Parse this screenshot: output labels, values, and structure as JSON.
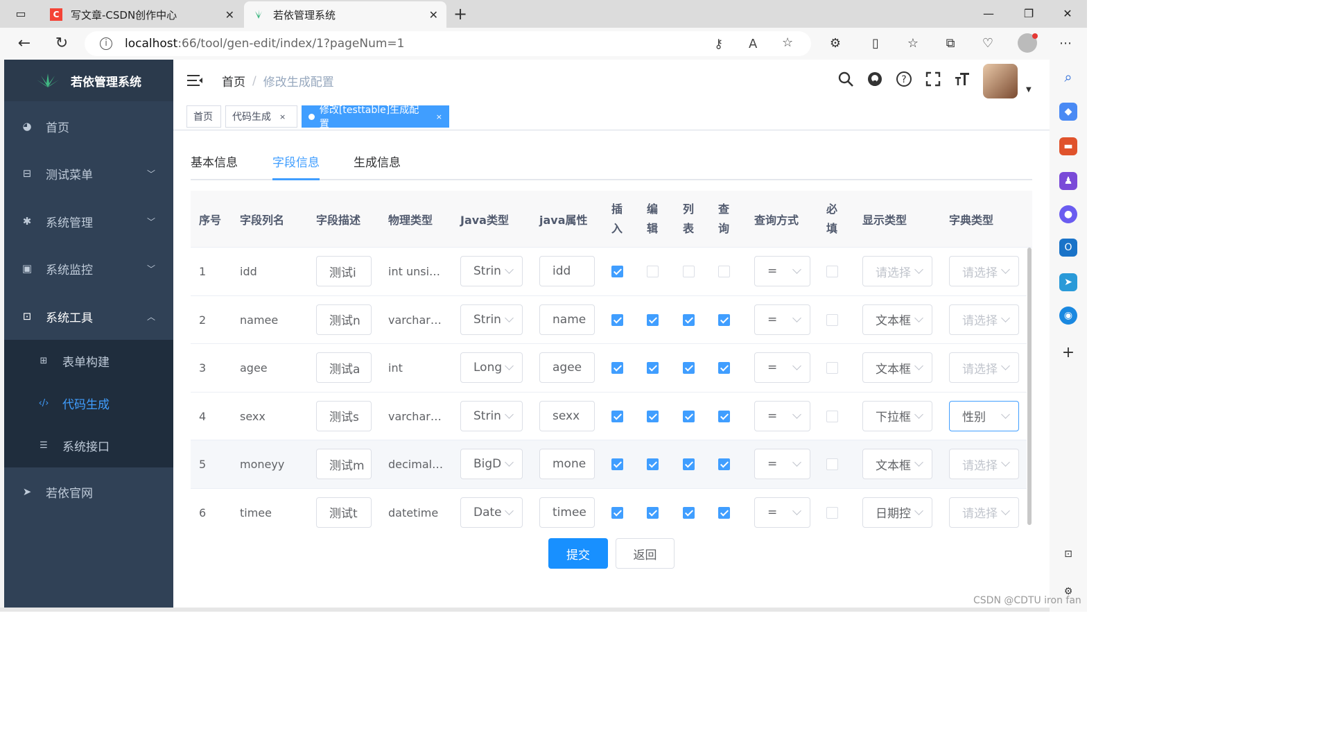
{
  "browser": {
    "tabs": [
      {
        "title": "写文章-CSDN创作中心",
        "favicon": "csdn-c-icon"
      },
      {
        "title": "若依管理系统",
        "favicon": "ruoyi-leaf-icon"
      }
    ],
    "url_host": "localhost",
    "url_path": ":66/tool/gen-edit/index/1?pageNum=1"
  },
  "sidebar": {
    "logo_title": "若依管理系统",
    "items": [
      {
        "label": "首页",
        "icon": "dashboard-icon"
      },
      {
        "label": "测试菜单",
        "icon": "tree-icon"
      },
      {
        "label": "系统管理",
        "icon": "gear-icon"
      },
      {
        "label": "系统监控",
        "icon": "monitor-icon"
      },
      {
        "label": "系统工具",
        "icon": "toolbox-icon"
      },
      {
        "label": "若依官网",
        "icon": "send-icon"
      }
    ],
    "sub_items": [
      {
        "label": "表单构建",
        "icon": "grid-icon"
      },
      {
        "label": "代码生成",
        "icon": "code-icon"
      },
      {
        "label": "系统接口",
        "icon": "sliders-icon"
      }
    ]
  },
  "breadcrumb": {
    "home": "首页",
    "current": "修改生成配置"
  },
  "tags": [
    {
      "label": "首页"
    },
    {
      "label": "代码生成",
      "close": "×"
    },
    {
      "label": "修改[testtable]生成配置",
      "close": "×"
    }
  ],
  "tabs": [
    {
      "label": "基本信息"
    },
    {
      "label": "字段信息"
    },
    {
      "label": "生成信息"
    }
  ],
  "table": {
    "headers": {
      "index": "序号",
      "column_name": "字段列名",
      "column_desc": "字段描述",
      "physical_type": "物理类型",
      "java_type": "Java类型",
      "java_field": "java属性",
      "insert": [
        "插",
        "入"
      ],
      "edit": [
        "编",
        "辑"
      ],
      "list": [
        "列",
        "表"
      ],
      "query": [
        "查",
        "询"
      ],
      "query_type": "查询方式",
      "required": [
        "必",
        "填"
      ],
      "html_type": "显示类型",
      "dict_type": "字典类型"
    },
    "rows": [
      {
        "index": "1",
        "column_name": "idd",
        "column_desc": "测试i",
        "physical_type": "int unsi…",
        "java_type": "Strin",
        "java_field": "idd",
        "insert": true,
        "edit": false,
        "list": false,
        "query": false,
        "query_type": "=",
        "required": false,
        "html_type": "请选择",
        "html_placeholder": true,
        "dict_type": "请选择",
        "dict_placeholder": true
      },
      {
        "index": "2",
        "column_name": "namee",
        "column_desc": "测试n",
        "physical_type": "varchar…",
        "java_type": "Strin",
        "java_field": "name",
        "insert": true,
        "edit": true,
        "list": true,
        "query": true,
        "query_type": "=",
        "required": false,
        "html_type": "文本框",
        "html_placeholder": false,
        "dict_type": "请选择",
        "dict_placeholder": true
      },
      {
        "index": "3",
        "column_name": "agee",
        "column_desc": "测试a",
        "physical_type": "int",
        "java_type": "Long",
        "java_field": "agee",
        "insert": true,
        "edit": true,
        "list": true,
        "query": true,
        "query_type": "=",
        "required": false,
        "html_type": "文本框",
        "html_placeholder": false,
        "dict_type": "请选择",
        "dict_placeholder": true
      },
      {
        "index": "4",
        "column_name": "sexx",
        "column_desc": "测试s",
        "physical_type": "varchar…",
        "java_type": "Strin",
        "java_field": "sexx",
        "insert": true,
        "edit": true,
        "list": true,
        "query": true,
        "query_type": "=",
        "required": false,
        "html_type": "下拉框",
        "html_placeholder": false,
        "dict_type": "性别",
        "dict_placeholder": false
      },
      {
        "index": "5",
        "column_name": "moneyy",
        "column_desc": "测试m",
        "physical_type": "decimal…",
        "java_type": "BigD",
        "java_field": "mone",
        "insert": true,
        "edit": true,
        "list": true,
        "query": true,
        "query_type": "=",
        "required": false,
        "html_type": "文本框",
        "html_placeholder": false,
        "dict_type": "请选择",
        "dict_placeholder": true
      },
      {
        "index": "6",
        "column_name": "timee",
        "column_desc": "测试t",
        "physical_type": "datetime",
        "java_type": "Date",
        "java_field": "timee",
        "insert": true,
        "edit": true,
        "list": true,
        "query": true,
        "query_type": "=",
        "required": false,
        "html_type": "日期控",
        "html_placeholder": false,
        "dict_type": "请选择",
        "dict_placeholder": true
      }
    ]
  },
  "buttons": {
    "submit": "提交",
    "back": "返回"
  },
  "watermark": "CSDN @CDTU iron fan",
  "colors": {
    "primary": "#409eff",
    "sidebar_bg": "#304156",
    "submenu_bg": "#1f2d3d",
    "submit_btn": "#1890ff"
  }
}
